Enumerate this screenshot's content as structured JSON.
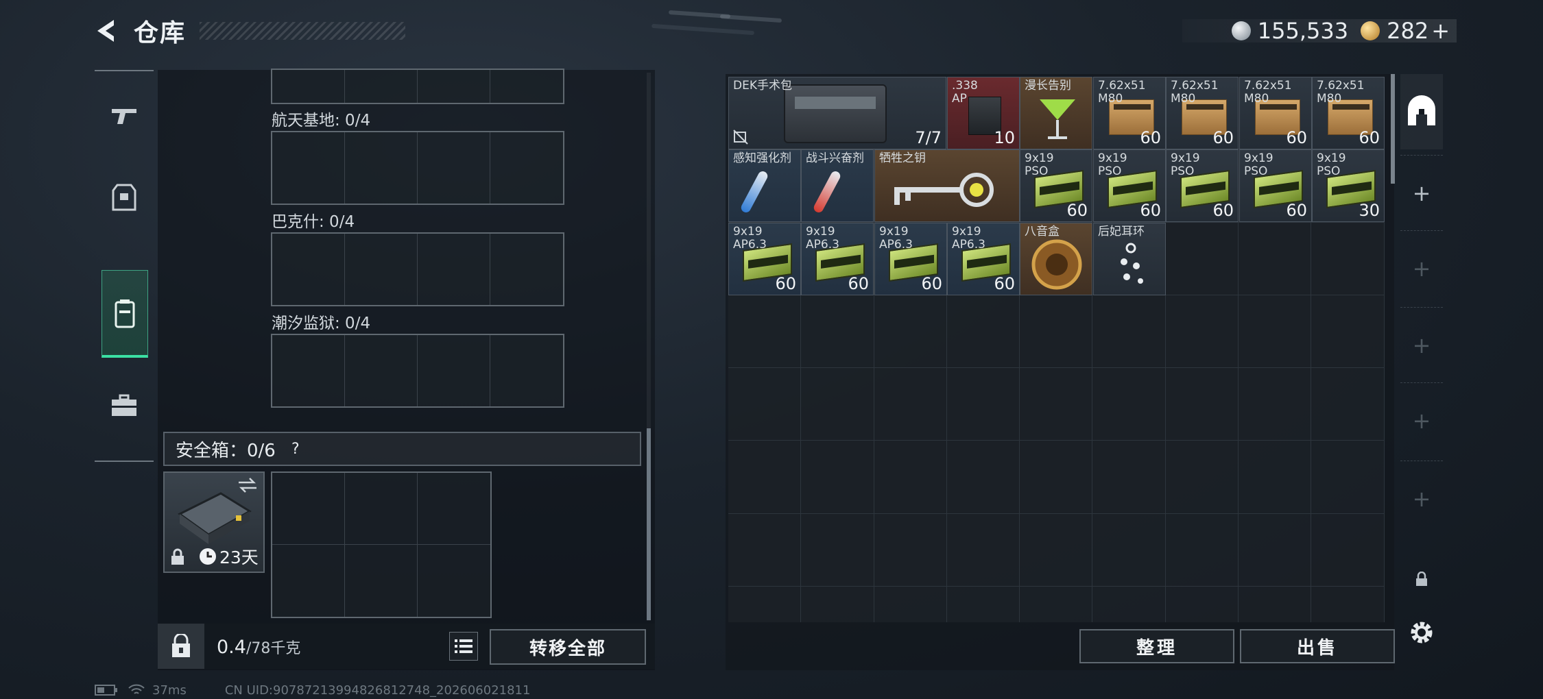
{
  "header": {
    "title": "仓库",
    "currency_silver": "155,533",
    "currency_gold": "282",
    "currency_plus": "+"
  },
  "left_panel": {
    "sections": [
      {
        "label": "航天基地: 0/4"
      },
      {
        "label": "巴克什: 0/4"
      },
      {
        "label": "潮汐监狱: 0/4"
      }
    ],
    "safe_box": {
      "label": "安全箱：0/6",
      "help": "?",
      "days": "23天"
    },
    "weight_value": "0.4",
    "weight_max": "/78千克",
    "transfer_all": "转移全部"
  },
  "stash": {
    "items": [
      {
        "name": "DEK手术包",
        "count": "7/7"
      },
      {
        "name": ".338\nAP",
        "count": "10"
      },
      {
        "name": "漫长告别",
        "count": ""
      },
      {
        "name": "7.62x51\nM80",
        "count": "60"
      },
      {
        "name": "7.62x51\nM80",
        "count": "60"
      },
      {
        "name": "7.62x51\nM80",
        "count": "60"
      },
      {
        "name": "7.62x51\nM80",
        "count": "60"
      },
      {
        "name": "感知强化剂",
        "count": ""
      },
      {
        "name": "战斗兴奋剂",
        "count": ""
      },
      {
        "name": "牺牲之钥",
        "count": ""
      },
      {
        "name": "9x19\nPSO",
        "count": "60"
      },
      {
        "name": "9x19\nPSO",
        "count": "60"
      },
      {
        "name": "9x19\nPSO",
        "count": "60"
      },
      {
        "name": "9x19\nPSO",
        "count": "60"
      },
      {
        "name": "9x19\nPSO",
        "count": "30"
      },
      {
        "name": "9x19\nAP6.3",
        "count": "60"
      },
      {
        "name": "9x19\nAP6.3",
        "count": "60"
      },
      {
        "name": "9x19\nAP6.3",
        "count": "60"
      },
      {
        "name": "9x19\nAP6.3",
        "count": "60"
      },
      {
        "name": "八音盒",
        "count": ""
      },
      {
        "name": "后妃耳环",
        "count": ""
      }
    ],
    "sort_label": "整理",
    "sell_label": "出售"
  },
  "status": {
    "ping": "37ms",
    "uid": "CN UID:907872139948268127​48_202606021811"
  },
  "colors": {
    "accent_green": "#3be0a3",
    "panel_border": "#5f6870"
  }
}
